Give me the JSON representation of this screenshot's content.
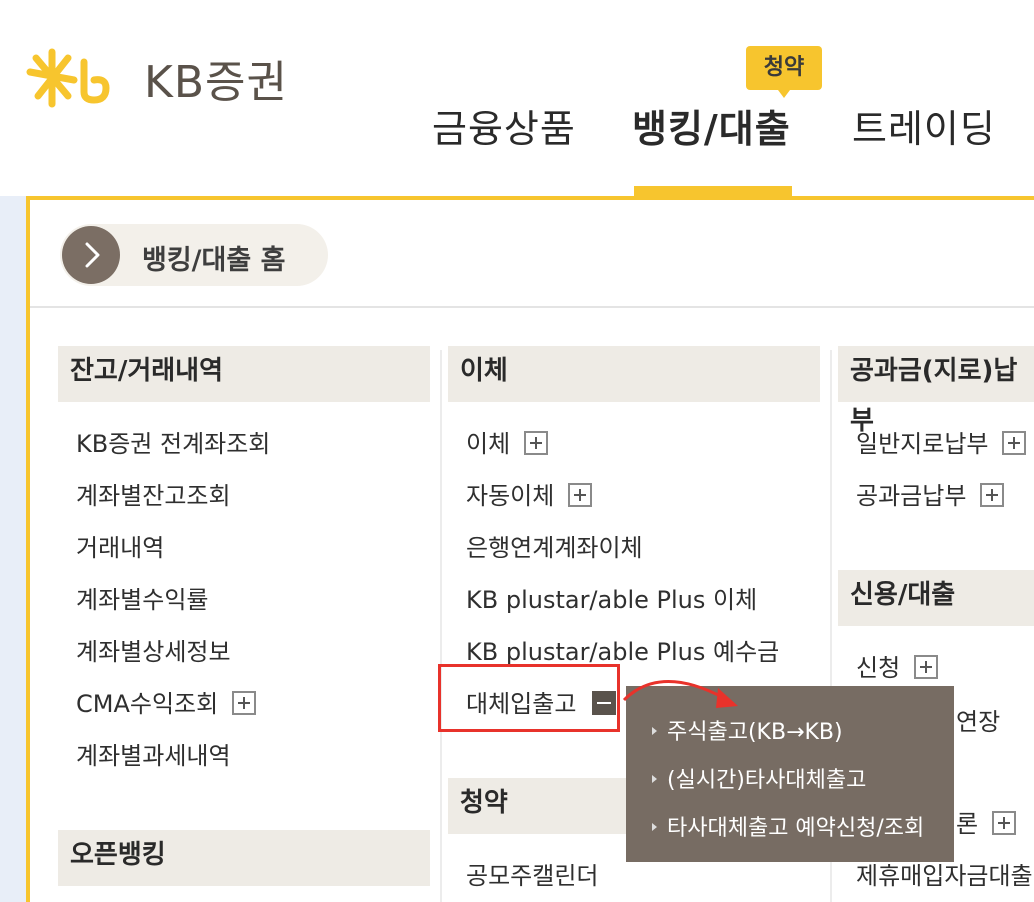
{
  "header": {
    "logo_text": "KB증권",
    "badge": "청약",
    "nav": [
      "금융상품",
      "뱅킹/대출",
      "트레이딩"
    ],
    "accent": "#f7c52e"
  },
  "panel": {
    "home_label": "뱅킹/대출 홈",
    "col1": {
      "title": "잔고/거래내역",
      "items": [
        "KB증권 전계좌조회",
        "계좌별잔고조회",
        "거래내역",
        "계좌별수익률",
        "계좌별상세정보",
        "CMA수익조회",
        "계좌별과세내역"
      ],
      "title2": "오픈뱅킹"
    },
    "col2": {
      "title": "이체",
      "items": [
        "이체",
        "자동이체",
        "은행연계계좌이체",
        "KB plustar/able Plus 이체",
        "KB plustar/able Plus 예수금",
        "대체입출고"
      ],
      "title2": "청약",
      "items2": [
        "공모주캘린더"
      ]
    },
    "col3": {
      "title": "공과금(지로)납부",
      "items": [
        "일반지로납부",
        "공과금납부"
      ],
      "title2": "신용/대출",
      "items2": [
        "신청",
        "연장",
        "론",
        "제휴매입자금대출"
      ]
    }
  },
  "popup": {
    "items": [
      "주식출고(KB→KB)",
      "(실시간)타사대체출고",
      "타사대체출고 예약신청/조회"
    ]
  }
}
